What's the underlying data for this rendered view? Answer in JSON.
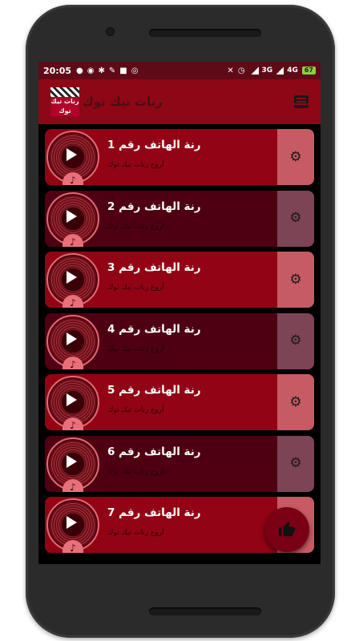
{
  "status_bar": {
    "time": "20:05",
    "network_1": "3G",
    "network_2": "4G",
    "battery": "67"
  },
  "app_bar": {
    "title": "رنات تيك توك",
    "logo_text": "رنات تيك توك"
  },
  "ringtones": [
    {
      "title": "رنة الهاتف رقم 1",
      "subtitle": "أروع رنات تيك توك",
      "style": "light"
    },
    {
      "title": "رنة الهاتف رقم 2",
      "subtitle": "أروع رنات تيك توك",
      "style": "dark"
    },
    {
      "title": "رنة الهاتف رقم 3",
      "subtitle": "أروع رنات تيك توك",
      "style": "light"
    },
    {
      "title": "رنة الهاتف رقم 4",
      "subtitle": "أروع رنات تيك توك",
      "style": "dark"
    },
    {
      "title": "رنة الهاتف رقم 5",
      "subtitle": "أروع رنات تيك توك",
      "style": "light"
    },
    {
      "title": "رنة الهاتف رقم 6",
      "subtitle": "أروع رنات تيك توك",
      "style": "dark"
    },
    {
      "title": "رنة الهاتف رقم 7",
      "subtitle": "أروع رنات تيك توك",
      "style": "light"
    }
  ],
  "icons": {
    "play": "play-icon",
    "settings": "gear-icon",
    "inbox": "inbox-icon",
    "like": "thumbs-up-icon"
  },
  "colors": {
    "app_bar": "#8e0716",
    "card_light": "#920415",
    "card_dark": "#4e0012",
    "fab": "#7a0016"
  }
}
